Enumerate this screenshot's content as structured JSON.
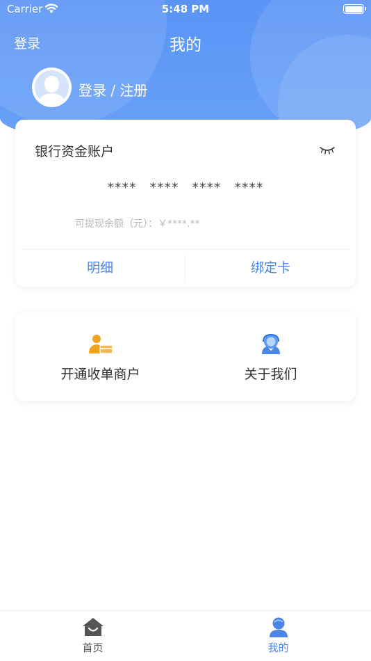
{
  "status_bar": {
    "carrier": "Carrier",
    "time": "5:48 PM"
  },
  "nav": {
    "login_label": "登录",
    "title": "我的"
  },
  "profile": {
    "login_register": "登录 / 注册"
  },
  "account_card": {
    "title": "银行资金账户",
    "masked_number": "**** **** **** ****",
    "balance_label": "可提现余额（元）：￥****.**",
    "detail_button": "明细",
    "bind_card_button": "绑定卡"
  },
  "menu": {
    "items": [
      {
        "label": "开通收单商户",
        "icon": "merchant-icon"
      },
      {
        "label": "关于我们",
        "icon": "about-us-icon"
      }
    ]
  },
  "tab_bar": {
    "tabs": [
      {
        "label": "首页",
        "icon": "home-icon",
        "active": false
      },
      {
        "label": "我的",
        "icon": "profile-icon",
        "active": true
      }
    ]
  },
  "colors": {
    "header_blue": "#5a94f5",
    "accent_blue": "#4a86e8",
    "merchant_orange": "#f4a11f",
    "text_dark": "#333333",
    "text_muted": "#bbbbbb"
  }
}
